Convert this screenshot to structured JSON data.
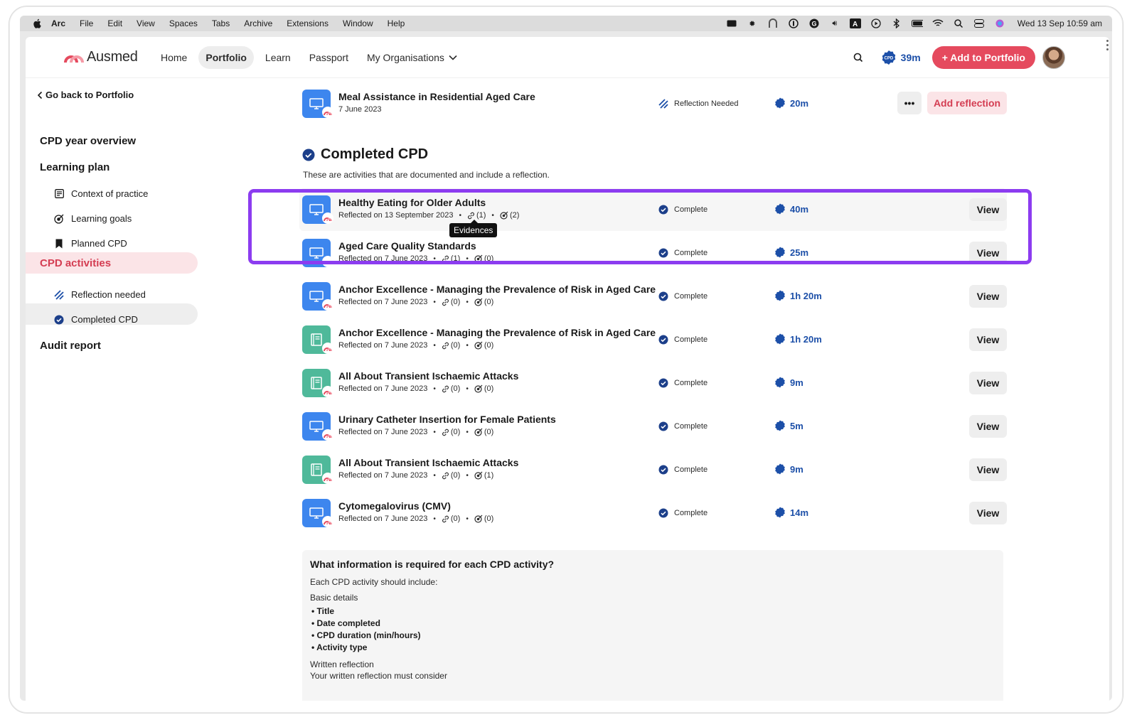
{
  "menubar": {
    "app": "Arc",
    "items": [
      "File",
      "Edit",
      "View",
      "Spaces",
      "Tabs",
      "Archive",
      "Extensions",
      "Window",
      "Help"
    ],
    "clock": "Wed 13 Sep  10:59 am"
  },
  "nav": {
    "logo": "Ausmed",
    "links": [
      "Home",
      "Portfolio",
      "Learn",
      "Passport",
      "My Organisations"
    ],
    "active": "Portfolio",
    "cpd_badge": "CPD",
    "cpd_time": "39m",
    "add_button": "+ Add to Portfolio"
  },
  "sidebar": {
    "back": "Go back to Portfolio",
    "cpd_year": "CPD year overview",
    "learning_plan": "Learning plan",
    "learning_items": [
      "Context of practice",
      "Learning goals",
      "Planned CPD"
    ],
    "cpd_activities": "CPD activities",
    "activity_items": [
      "Reflection needed",
      "Completed CPD"
    ],
    "audit": "Audit report"
  },
  "pending": {
    "title": "Meal Assistance in Residential Aged Care",
    "date": "7 June 2023",
    "status": "Reflection Needed",
    "duration": "20m",
    "more": "•••",
    "action": "Add reflection"
  },
  "completed": {
    "heading": "Completed CPD",
    "description": "These are activities that are documented and include a reflection.",
    "tooltip": "Evidences",
    "view_label": "View",
    "rows": [
      {
        "title": "Healthy Eating for Older Adults",
        "meta": "Reflected on 13 September 2023",
        "links": "(1)",
        "goals": "(2)",
        "status": "Complete",
        "duration": "40m",
        "kind": "blue"
      },
      {
        "title": "Aged Care Quality Standards",
        "meta": "Reflected on 7 June 2023",
        "links": "(1)",
        "goals": "(0)",
        "status": "Complete",
        "duration": "25m",
        "kind": "blue"
      },
      {
        "title": "Anchor Excellence - Managing the Prevalence of Risk in Aged Care",
        "meta": "Reflected on 7 June 2023",
        "links": "(0)",
        "goals": "(0)",
        "status": "Complete",
        "duration": "1h 20m",
        "kind": "blue"
      },
      {
        "title": "Anchor Excellence - Managing the Prevalence of Risk in Aged Care",
        "meta": "Reflected on 7 June 2023",
        "links": "(0)",
        "goals": "(0)",
        "status": "Complete",
        "duration": "1h 20m",
        "kind": "green"
      },
      {
        "title": "All About Transient Ischaemic Attacks",
        "meta": "Reflected on 7 June 2023",
        "links": "(0)",
        "goals": "(0)",
        "status": "Complete",
        "duration": "9m",
        "kind": "green"
      },
      {
        "title": "Urinary Catheter Insertion for Female Patients",
        "meta": "Reflected on 7 June 2023",
        "links": "(0)",
        "goals": "(0)",
        "status": "Complete",
        "duration": "5m",
        "kind": "blue"
      },
      {
        "title": "All About Transient Ischaemic Attacks",
        "meta": "Reflected on 7 June 2023",
        "links": "(0)",
        "goals": "(1)",
        "status": "Complete",
        "duration": "9m",
        "kind": "green"
      },
      {
        "title": "Cytomegalovirus (CMV)",
        "meta": "Reflected on 7 June 2023",
        "links": "(0)",
        "goals": "(0)",
        "status": "Complete",
        "duration": "14m",
        "kind": "blue"
      }
    ]
  },
  "info": {
    "title": "What information is required for each CPD activity?",
    "intro": "Each CPD activity should include:",
    "basic": "Basic details",
    "basic_items": [
      "Title",
      "Date completed",
      "CPD duration (min/hours)",
      "Activity type"
    ],
    "written": "Written reflection",
    "written_intro": "Your written reflection must consider"
  },
  "colors": {
    "brand": "#e54a5e",
    "cpd_blue": "#1c4fa8",
    "highlight": "#8c3cf0"
  }
}
